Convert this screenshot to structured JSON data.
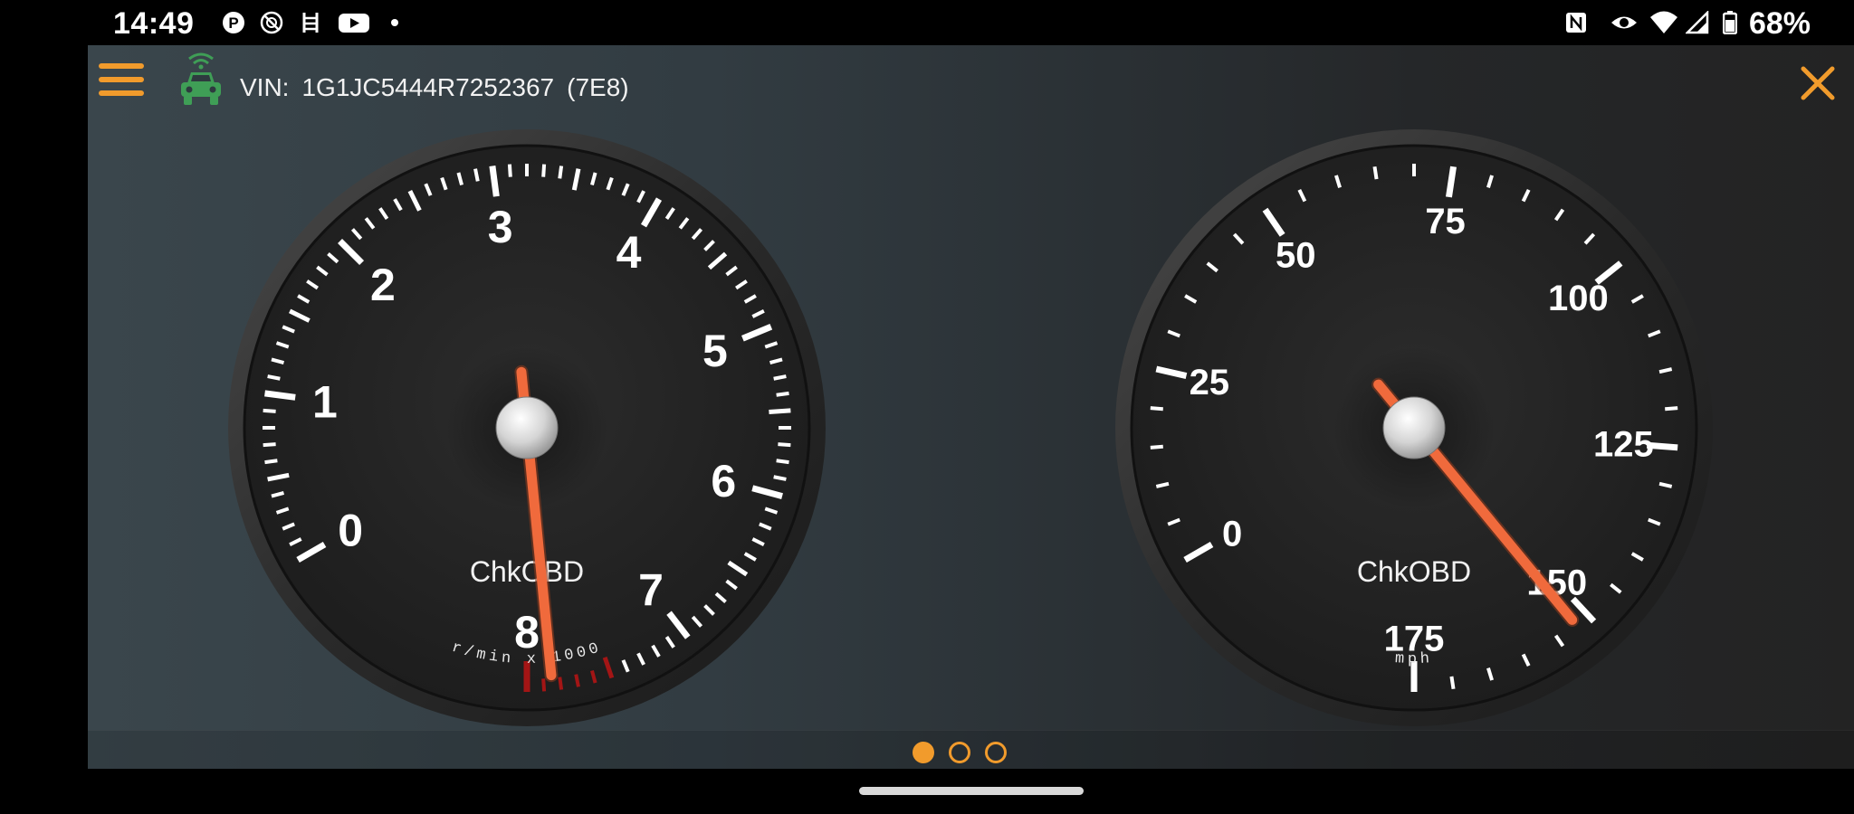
{
  "status_bar": {
    "time": "14:49",
    "battery_text": "68%",
    "left_icons": [
      "parking-app-icon",
      "no-tracking-icon",
      "ladder-app-icon",
      "youtube-icon",
      "more-dot-icon"
    ],
    "right_icons": [
      "nfc-icon",
      "eye-icon",
      "wifi-icon",
      "cell-signal-icon",
      "battery-icon"
    ]
  },
  "header": {
    "vin_prefix": "VIN:",
    "vin": "1G1JC5444R7252367",
    "ecu": "(7E8)",
    "icons": {
      "menu": "menu-icon",
      "vehicle": "car-wireless-icon",
      "close": "close-icon"
    }
  },
  "colors": {
    "accent": "#f19b2c",
    "needle": "#f06a3c",
    "redline": "#a31515",
    "connected": "#3f9e56"
  },
  "gauges": [
    {
      "id": "tachometer",
      "brand": "ChkOBD",
      "unit": "r/min x 1000",
      "labels": [
        "0",
        "1",
        "2",
        "3",
        "4",
        "5",
        "6",
        "7",
        "8"
      ],
      "range": [
        0,
        8
      ],
      "value": 7.85,
      "redline_from": 7.5
    },
    {
      "id": "speedometer",
      "brand": "ChkOBD",
      "unit": "mph",
      "labels": [
        "0",
        "25",
        "50",
        "75",
        "100",
        "125",
        "150",
        "175"
      ],
      "range": [
        0,
        175
      ],
      "value": 152
    }
  ],
  "pager": {
    "pages": 3,
    "active": 0
  }
}
